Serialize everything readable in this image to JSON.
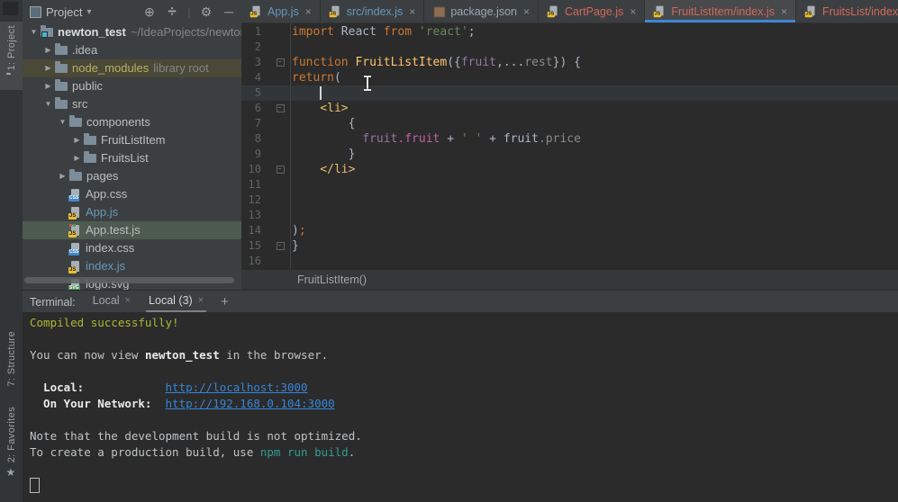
{
  "colors": {
    "panel_bg": "#3c3f41",
    "editor_bg": "#2b2b2b",
    "accent_underline": "#3e86d6",
    "tab_blue": "#6996bb",
    "tab_salmon": "#d1685c",
    "keyword": "#cc7832",
    "string": "#6a8759",
    "function_name": "#ffc66d",
    "html_tag": "#e8bf6a",
    "field_purple": "#9876aa",
    "selection_green": "#4d5b50",
    "library_row": "#4a4836",
    "terminal_green": "#abb934",
    "terminal_link": "#3585d8",
    "terminal_teal": "#2f9c95"
  },
  "activity_bar": {
    "items": [
      {
        "label": "1: Project",
        "icon": "project-folder-icon",
        "active": true
      },
      {
        "label": "7: Structure",
        "icon": "structure-icon",
        "active": false
      },
      {
        "label": "2: Favorites",
        "icon": "star-icon",
        "active": false
      }
    ]
  },
  "project_panel": {
    "header": {
      "title": "Project",
      "caret": "▾",
      "icons": [
        "locate-file-icon",
        "collapse-all-icon",
        "settings-gear-icon",
        "hide-panel-icon"
      ]
    },
    "tree": [
      {
        "label": "newton_test",
        "suffix": "~/IdeaProjects/newton",
        "indent": 0,
        "arrow": "down",
        "icon": "folder",
        "style": "root"
      },
      {
        "label": ".idea",
        "indent": 1,
        "arrow": "right",
        "icon": "folder",
        "style": ""
      },
      {
        "label": "node_modules",
        "suffix": "library root",
        "indent": 1,
        "arrow": "right",
        "icon": "folder",
        "style": "library"
      },
      {
        "label": "public",
        "indent": 1,
        "arrow": "right",
        "icon": "folder",
        "style": ""
      },
      {
        "label": "src",
        "indent": 1,
        "arrow": "down",
        "icon": "folder",
        "style": ""
      },
      {
        "label": "components",
        "indent": 2,
        "arrow": "down",
        "icon": "folder",
        "style": ""
      },
      {
        "label": "FruitListItem",
        "indent": 3,
        "arrow": "right",
        "icon": "folder",
        "style": ""
      },
      {
        "label": "FruitsList",
        "indent": 3,
        "arrow": "right",
        "icon": "folder",
        "style": ""
      },
      {
        "label": "pages",
        "indent": 2,
        "arrow": "right",
        "icon": "folder",
        "style": ""
      },
      {
        "label": "App.css",
        "indent": 2,
        "arrow": "",
        "icon": "css",
        "style": ""
      },
      {
        "label": "App.js",
        "indent": 2,
        "arrow": "",
        "icon": "js",
        "style": "modified"
      },
      {
        "label": "App.test.js",
        "indent": 2,
        "arrow": "",
        "icon": "test",
        "style": "selected"
      },
      {
        "label": "index.css",
        "indent": 2,
        "arrow": "",
        "icon": "css",
        "style": ""
      },
      {
        "label": "index.js",
        "indent": 2,
        "arrow": "",
        "icon": "js",
        "style": "modified"
      },
      {
        "label": "logo.svg",
        "indent": 2,
        "arrow": "",
        "icon": "svg",
        "style": ""
      }
    ]
  },
  "editor": {
    "tabs": [
      {
        "label": "App.js",
        "icon": "js",
        "color": "blue",
        "active": false
      },
      {
        "label": "src/index.js",
        "icon": "js",
        "color": "blue",
        "active": false
      },
      {
        "label": "package.json",
        "icon": "npm",
        "color": "gray",
        "active": false
      },
      {
        "label": "CartPage.js",
        "icon": "js",
        "color": "salmon",
        "active": false
      },
      {
        "label": "FruitListItem/index.js",
        "icon": "js",
        "color": "salmon",
        "active": true
      },
      {
        "label": "FruitsList/index.js",
        "icon": "js",
        "color": "salmon",
        "active": false
      }
    ],
    "close_glyph": "×",
    "code": {
      "lines": [
        {
          "n": 1,
          "fold": false,
          "cursor": false,
          "highlight": false,
          "seg": [
            [
              "kw",
              "import"
            ],
            [
              "pl",
              " React "
            ],
            [
              "kw",
              "from"
            ],
            [
              "st",
              " 'react'"
            ],
            [
              "pl",
              ";"
            ]
          ]
        },
        {
          "n": 2,
          "fold": false,
          "cursor": false,
          "highlight": false,
          "seg": []
        },
        {
          "n": 3,
          "fold": true,
          "cursor": false,
          "highlight": false,
          "seg": [
            [
              "kw",
              "function"
            ],
            [
              "fn",
              " FruitListItem"
            ],
            [
              "pl",
              "({"
            ],
            [
              "fd",
              "fruit"
            ],
            [
              "pl",
              ",..."
            ],
            [
              "gr",
              "rest"
            ],
            [
              "pl",
              "}) {"
            ]
          ]
        },
        {
          "n": 4,
          "fold": false,
          "cursor": false,
          "highlight": false,
          "seg": [
            [
              "kw",
              "return"
            ],
            [
              "pl",
              "("
            ]
          ]
        },
        {
          "n": 5,
          "fold": false,
          "cursor": true,
          "highlight": true,
          "seg": []
        },
        {
          "n": 6,
          "fold": true,
          "cursor": false,
          "highlight": false,
          "seg": [
            [
              "tg",
              "    <li>"
            ]
          ]
        },
        {
          "n": 7,
          "fold": false,
          "cursor": false,
          "highlight": false,
          "seg": [
            [
              "pl",
              "        {"
            ]
          ]
        },
        {
          "n": 8,
          "fold": false,
          "cursor": false,
          "highlight": false,
          "seg": [
            [
              "fd",
              "          fruit"
            ],
            [
              "pk",
              ".fruit"
            ],
            [
              "pl",
              " + "
            ],
            [
              "st",
              "' '"
            ],
            [
              "pl",
              " + fruit"
            ],
            [
              "gr",
              ".price"
            ]
          ]
        },
        {
          "n": 9,
          "fold": false,
          "cursor": false,
          "highlight": false,
          "seg": [
            [
              "pl",
              "        }"
            ]
          ]
        },
        {
          "n": 10,
          "fold": true,
          "cursor": false,
          "highlight": false,
          "seg": [
            [
              "tg",
              "    </li>"
            ]
          ]
        },
        {
          "n": 11,
          "fold": false,
          "cursor": false,
          "highlight": false,
          "seg": []
        },
        {
          "n": 12,
          "fold": false,
          "cursor": false,
          "highlight": false,
          "seg": []
        },
        {
          "n": 13,
          "fold": false,
          "cursor": false,
          "highlight": false,
          "seg": []
        },
        {
          "n": 14,
          "fold": false,
          "cursor": false,
          "highlight": false,
          "seg": [
            [
              "pl",
              ")"
            ],
            [
              "kw",
              ";"
            ]
          ]
        },
        {
          "n": 15,
          "fold": true,
          "cursor": false,
          "highlight": false,
          "seg": [
            [
              "pl",
              "}"
            ]
          ]
        },
        {
          "n": 16,
          "fold": false,
          "cursor": false,
          "highlight": false,
          "seg": []
        }
      ]
    },
    "breadcrumb": "FruitListItem()"
  },
  "terminal": {
    "label": "Terminal:",
    "tabs": [
      {
        "label": "Local",
        "active": false
      },
      {
        "label": "Local (3)",
        "active": true
      }
    ],
    "close_glyph": "×",
    "new_tab_glyph": "+",
    "lines": [
      [
        [
          "g",
          "Compiled successfully!"
        ]
      ],
      [],
      [
        [
          "p",
          "You can now view "
        ],
        [
          "b",
          "newton_test"
        ],
        [
          "p",
          " in the browser."
        ]
      ],
      [],
      [
        [
          "b",
          "  Local:            "
        ],
        [
          "l",
          "http://localhost:3000"
        ]
      ],
      [
        [
          "b",
          "  On Your Network:  "
        ],
        [
          "l",
          "http://192.168.0.104:3000"
        ]
      ],
      [],
      [
        [
          "p",
          "Note that the development build is not optimized."
        ]
      ],
      [
        [
          "p",
          "To create a production build, use "
        ],
        [
          "t",
          "npm run build"
        ],
        [
          "p",
          "."
        ]
      ],
      [],
      [
        [
          "cursor",
          ""
        ]
      ]
    ]
  }
}
